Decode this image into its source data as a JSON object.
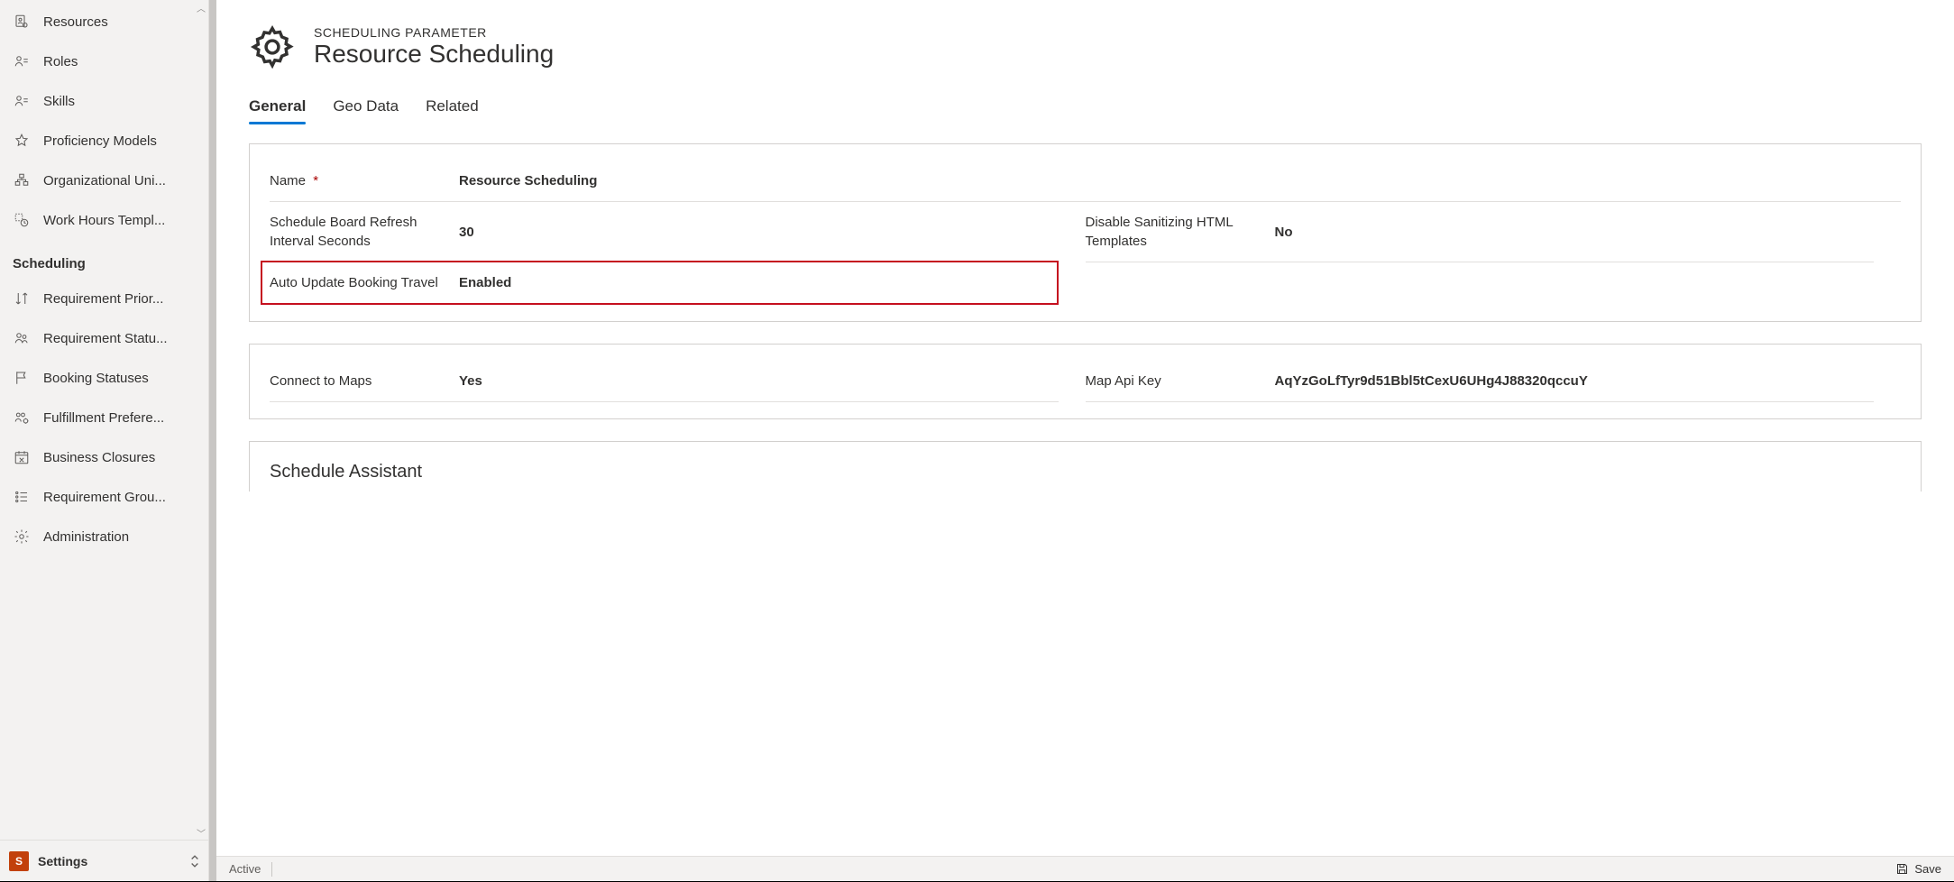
{
  "sidebar": {
    "group1": [
      {
        "label": "Resources"
      },
      {
        "label": "Roles"
      },
      {
        "label": "Skills"
      },
      {
        "label": "Proficiency Models"
      },
      {
        "label": "Organizational Uni..."
      },
      {
        "label": "Work Hours Templ..."
      }
    ],
    "section_label": "Scheduling",
    "group2": [
      {
        "label": "Requirement Prior..."
      },
      {
        "label": "Requirement Statu..."
      },
      {
        "label": "Booking Statuses"
      },
      {
        "label": "Fulfillment Prefere..."
      },
      {
        "label": "Business Closures"
      },
      {
        "label": "Requirement Grou..."
      },
      {
        "label": "Administration"
      }
    ]
  },
  "area": {
    "badge": "S",
    "label": "Settings"
  },
  "header": {
    "sub": "SCHEDULING PARAMETER",
    "title": "Resource Scheduling"
  },
  "tabs": {
    "t0": "General",
    "t1": "Geo Data",
    "t2": "Related"
  },
  "fields": {
    "name_label": "Name",
    "name_value": "Resource Scheduling",
    "refresh_label": "Schedule Board Refresh Interval Seconds",
    "refresh_value": "30",
    "sanitize_label": "Disable Sanitizing HTML Templates",
    "sanitize_value": "No",
    "auto_label": "Auto Update Booking Travel",
    "auto_value": "Enabled",
    "connect_label": "Connect to Maps",
    "connect_value": "Yes",
    "apikey_label": "Map Api Key",
    "apikey_value": "AqYzGoLfTyr9d51Bbl5tCexU6UHg4J88320qccuY"
  },
  "sections": {
    "schedule_assistant": "Schedule Assistant"
  },
  "statusbar": {
    "state": "Active",
    "save": "Save"
  }
}
